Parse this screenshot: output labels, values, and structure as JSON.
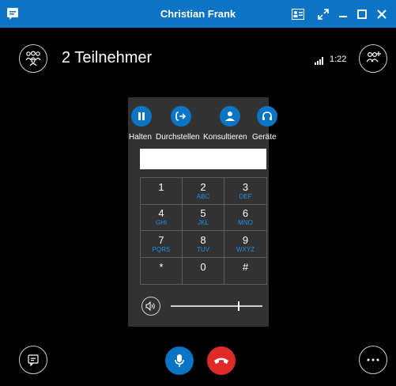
{
  "window": {
    "title": "Christian Frank"
  },
  "header": {
    "participants_label": "2 Teilnehmer",
    "call_duration": "1:22"
  },
  "dialpad": {
    "actions": [
      {
        "label": "Halten",
        "icon": "pause-icon"
      },
      {
        "label": "Durchstellen",
        "icon": "transfer-icon"
      },
      {
        "label": "Konsultieren",
        "icon": "consult-icon"
      },
      {
        "label": "Geräte",
        "icon": "headset-icon"
      }
    ],
    "number_value": "",
    "keys": [
      {
        "digit": "1",
        "letters": ""
      },
      {
        "digit": "2",
        "letters": "ABC"
      },
      {
        "digit": "3",
        "letters": "DEF"
      },
      {
        "digit": "4",
        "letters": "GHI"
      },
      {
        "digit": "5",
        "letters": "JKL"
      },
      {
        "digit": "6",
        "letters": "MNO"
      },
      {
        "digit": "7",
        "letters": "PQRS"
      },
      {
        "digit": "8",
        "letters": "TUV"
      },
      {
        "digit": "9",
        "letters": "WXYZ"
      },
      {
        "digit": "*",
        "letters": ""
      },
      {
        "digit": "0",
        "letters": ""
      },
      {
        "digit": "#",
        "letters": ""
      }
    ],
    "volume_level": 0.73
  },
  "colors": {
    "accent": "#0b74c4",
    "hangup": "#e02a2a",
    "key_letters": "#1e90e6"
  }
}
